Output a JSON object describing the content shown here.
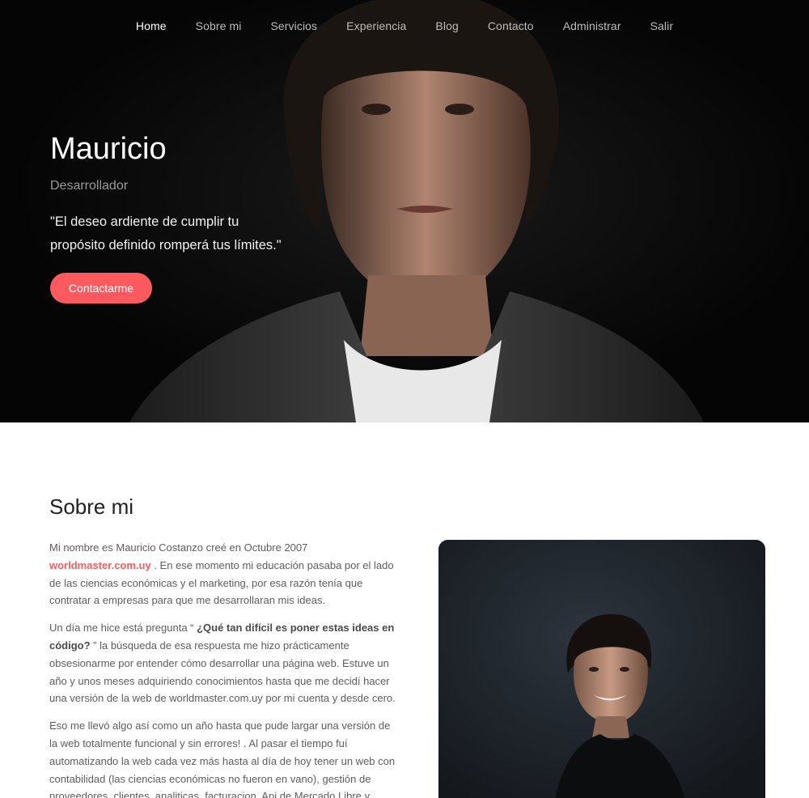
{
  "nav": {
    "items": [
      {
        "label": "Home",
        "active": true
      },
      {
        "label": "Sobre mi",
        "active": false
      },
      {
        "label": "Servicios",
        "active": false
      },
      {
        "label": "Experiencia",
        "active": false
      },
      {
        "label": "Blog",
        "active": false
      },
      {
        "label": "Contacto",
        "active": false
      },
      {
        "label": "Administrar",
        "active": false
      },
      {
        "label": "Salir",
        "active": false
      }
    ]
  },
  "hero": {
    "name": "Mauricio",
    "role": "Desarrollador",
    "quote": "\"El deseo ardiente de cumplir tu propósito definido romperá tus límites.\"",
    "cta_label": "Contactarme"
  },
  "about": {
    "title": "Sobre mi",
    "p1_before": "Mi nombre es Mauricio Costanzo creé en Octubre 2007 ",
    "p1_link": "worldmaster.com.uy",
    "p1_after": " . En ese momento mi educación pasaba por el lado de las ciencias económicas y el marketing, por esa razón tenía que contratar a empresas para que me desarrollaran mis ideas.",
    "p2_before": "Un día me hice está pregunta “ ",
    "p2_bold": "¿Qué tan difícil es poner estas ideas en código?",
    "p2_after": " ” la búsqueda de esa respuesta me hizo prácticamente obsesionarme por entender cómo desarrollar una página web. Estuve un año y unos meses adquiriendo conocimientos hasta que me decidí hacer una versión de la web de worldmaster.com.uy por mi cuenta y desde cero.",
    "p3": "Eso me llevó algo así como un año hasta que pude largar una versión de la web totalmente funcional y sin errores! . Al pasar el tiempo fuí automatizando la web cada vez más hasta al día de hoy tener un web con contabilidad (las ciencias económicas no fueron en vano), gestión de proveedores, clientes, analiticas, facturacion, Api de Mercado Libre y redes"
  },
  "colors": {
    "accent": "#fc5a5e",
    "hero_bg": "#060606",
    "photo_bg": "#1f252d"
  }
}
